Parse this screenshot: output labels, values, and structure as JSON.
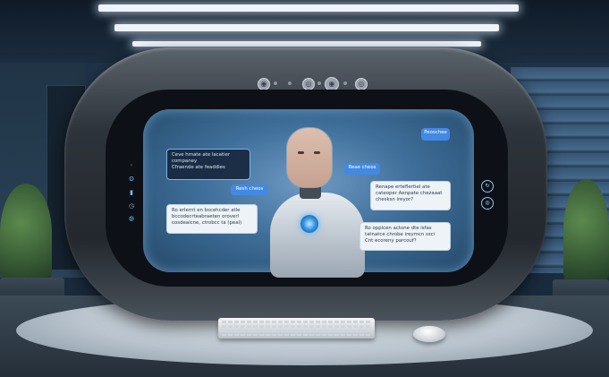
{
  "bubbles": {
    "top_right_label": "Peoschee",
    "left_top": [
      "Ceve hmate ate lacatier",
      "companey",
      "Cfraende ate feaddies"
    ],
    "left_label": "Resh cheos",
    "center_label": "Reae cheos",
    "left_bottom": [
      "Ro erlernt en bscehcder atle",
      "bccodecrteabraeten oroverl",
      "cosdeaicne, ctrobcc ta (peal)"
    ],
    "right_top": [
      "Renape erteflertiel ate",
      "cateoper Aenpate chezaaat",
      "chesksn ireyor?"
    ],
    "right_bottom": [
      "Ro opplcen actone dte isfas",
      "tatnatce chrobe ireymcn ssci",
      "Cnt ecoreny parcouf?"
    ]
  },
  "controls": {
    "top_buttons": [
      "◉",
      "◎",
      "◉",
      "◎"
    ],
    "left_side_icons": [
      "◦",
      "ʘ",
      "▮",
      "◷",
      "◍"
    ],
    "right_side_buttons": [
      "↻",
      "◎"
    ]
  }
}
